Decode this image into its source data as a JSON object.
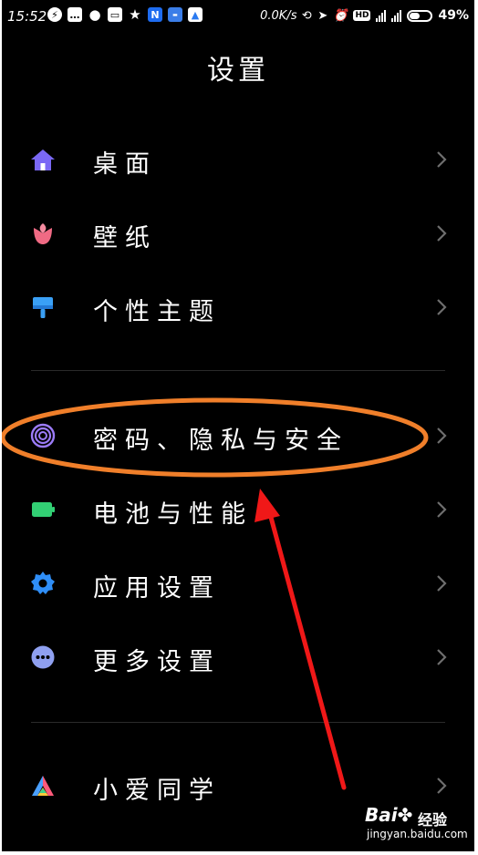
{
  "status_bar": {
    "time": "15:52",
    "net_speed": "0.0K/s",
    "hd_label": "HD",
    "battery_percent": "49%",
    "battery_level": 0.49,
    "notification_icons": [
      "bolt-icon",
      "message-icon",
      "drop-icon",
      "vr-icon",
      "star-icon",
      "app-n-icon",
      "app-blue-icon",
      "app-a-icon"
    ],
    "system_icons": [
      "sync-icon",
      "location-icon",
      "alarm-icon",
      "hd-icon",
      "signal-icon",
      "signal-icon",
      "battery-icon"
    ]
  },
  "header": {
    "title": "设置"
  },
  "settings": {
    "items": [
      {
        "label": "桌面",
        "icon": "home-icon",
        "color": "#7a68f5"
      },
      {
        "label": "壁纸",
        "icon": "flower-icon",
        "color": "#f06a84"
      },
      {
        "label": "个性主题",
        "icon": "brush-icon",
        "color": "#3aa0f5"
      },
      {
        "label": "密码、隐私与安全",
        "icon": "fingerprint-icon",
        "color": "#9b7bf7"
      },
      {
        "label": "电池与性能",
        "icon": "battery-icon",
        "color": "#32d074"
      },
      {
        "label": "应用设置",
        "icon": "gear-icon",
        "color": "#2f8ef7"
      },
      {
        "label": "更多设置",
        "icon": "more-icon",
        "color": "#8fa0f0"
      },
      {
        "label": "小爱同学",
        "icon": "xiaoai-icon",
        "color": "#4aa0ff"
      }
    ]
  },
  "annotation": {
    "ellipse_color": "#f07f2a",
    "arrow_color": "#f01818"
  },
  "watermark": {
    "logo": "Bai",
    "logo_suffix": "du",
    "text": "经验",
    "domain": "jingyan.baidu.com"
  }
}
